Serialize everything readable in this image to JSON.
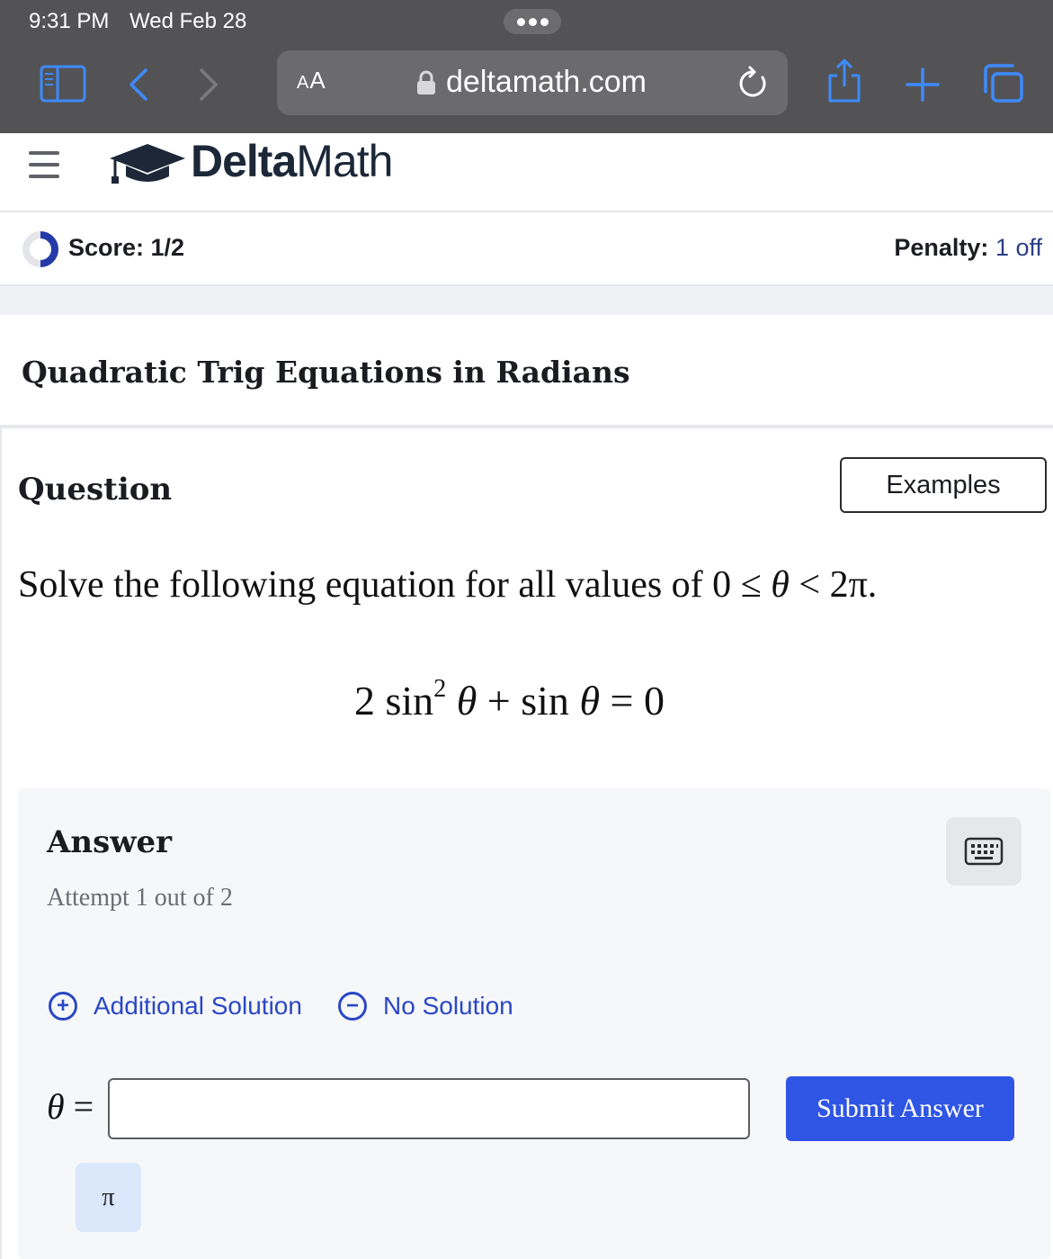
{
  "status_bar": {
    "time": "9:31 PM",
    "date": "Wed Feb 28"
  },
  "browser": {
    "text_size_label_small": "A",
    "text_size_label_large": "A",
    "url": "deltamath.com",
    "icons": [
      "sidebar-icon",
      "back-icon",
      "forward-icon",
      "lock-icon",
      "reload-icon",
      "share-icon",
      "new-tab-icon",
      "tabs-icon"
    ]
  },
  "app": {
    "brand_bold": "Delta",
    "brand_regular": "Math",
    "score_label": "Score: 1/2",
    "score_fraction": 0.5,
    "penalty_label": "Penalty:",
    "penalty_value": "1 off"
  },
  "assignment": {
    "title": "Quadratic Trig Equations in Radians"
  },
  "question": {
    "heading": "Question",
    "examples_button": "Examples",
    "prompt_text": "Solve the following equation for all values of ",
    "prompt_range_zero": "0",
    "prompt_le": "≤",
    "prompt_theta": "θ",
    "prompt_lt": "<",
    "prompt_two_pi": "2π",
    "prompt_end": ".",
    "equation": {
      "coef": "2",
      "sin1": "sin",
      "power": "2",
      "theta1": "θ",
      "plus": "+",
      "sin2": "sin",
      "theta2": "θ",
      "equals": "=",
      "rhs": "0"
    }
  },
  "answer": {
    "heading": "Answer",
    "attempt": "Attempt 1 out of 2",
    "add_solution": "Additional Solution",
    "no_solution": "No Solution",
    "variable": "θ",
    "equals": "=",
    "input_value": "",
    "submit": "Submit Answer",
    "pi_key": "π"
  },
  "colors": {
    "browser_chrome": "#535356",
    "link_blue": "#2a48c6",
    "submit_blue": "#2f55e4",
    "pi_key_bg": "#dbe7fb"
  }
}
